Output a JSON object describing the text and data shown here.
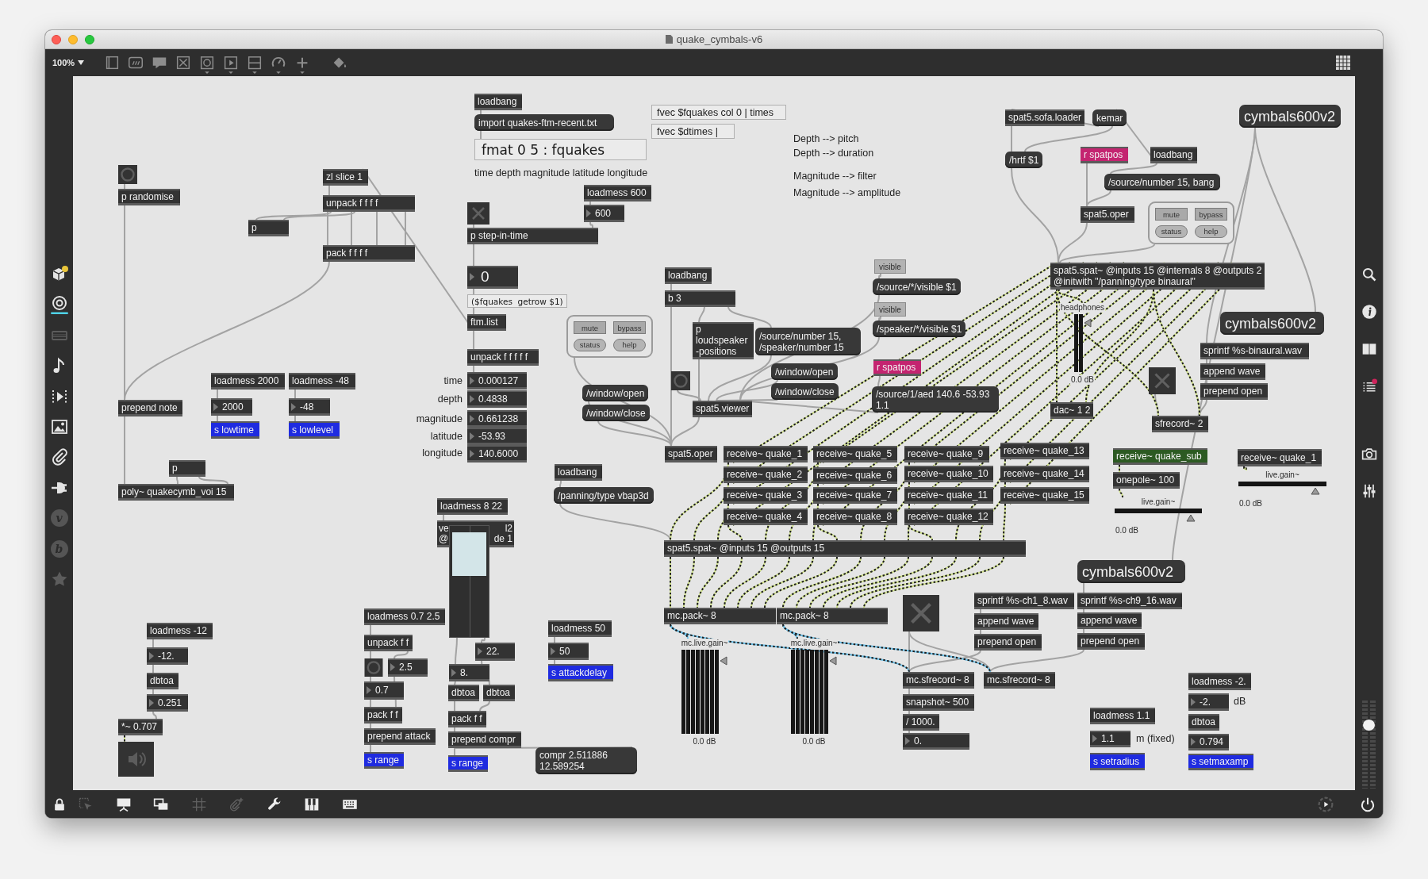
{
  "window": {
    "title": "quake_cymbals-v6"
  },
  "toolbar": {
    "zoom": "100%"
  },
  "left_sidebar": {
    "items": [
      {
        "kind": "icon",
        "selected": false,
        "disabled": false
      },
      {
        "kind": "icon",
        "selected": true,
        "disabled": false
      },
      {
        "kind": "icon",
        "selected": false,
        "disabled": true
      },
      {
        "kind": "icon",
        "selected": false,
        "disabled": false
      },
      {
        "kind": "icon",
        "selected": false,
        "disabled": false
      },
      {
        "kind": "icon",
        "selected": false,
        "disabled": false
      },
      {
        "kind": "icon",
        "selected": false,
        "disabled": false
      },
      {
        "kind": "icon",
        "selected": false,
        "disabled": false
      },
      {
        "kind": "letter",
        "label": "v",
        "selected": false,
        "disabled": true
      },
      {
        "kind": "letter",
        "label": "b",
        "selected": false,
        "disabled": true
      },
      {
        "kind": "icon",
        "selected": false,
        "disabled": true
      }
    ]
  },
  "right_sidebar": {
    "volume": {
      "level": 0.75
    }
  },
  "patcher": {
    "objects": [
      {
        "kind": "object",
        "text": "loadbang"
      },
      {
        "kind": "message",
        "text": "import quakes-ftm-recent.txt"
      },
      {
        "kind": "ftm",
        "text": "fvec $fquakes col 0 | times"
      },
      {
        "kind": "ftm",
        "text": "fvec $dtimes |"
      },
      {
        "kind": "object",
        "text": "spat5.sofa.loader"
      },
      {
        "kind": "message",
        "text": "kemar"
      },
      {
        "kind": "bigmessage",
        "text": "cymbals600v2"
      },
      {
        "kind": "ftmlarge",
        "text": "fmat 0 5 : fquakes"
      },
      {
        "kind": "comment",
        "text": "Depth --> pitch"
      },
      {
        "kind": "comment",
        "text": "Depth --> duration"
      },
      {
        "kind": "bang"
      },
      {
        "kind": "object",
        "text": "zl slice 1"
      },
      {
        "kind": "comment",
        "text": "time depth magnitude latitude longitude"
      },
      {
        "kind": "message",
        "text": "/hrtf $1"
      },
      {
        "kind": "receive",
        "text": "r spatpos"
      },
      {
        "kind": "object",
        "text": "loadbang"
      },
      {
        "kind": "comment",
        "text": "Magnitude --> filter"
      },
      {
        "kind": "object",
        "text": "p randomise"
      },
      {
        "kind": "object",
        "text": "unpack f f f f"
      },
      {
        "kind": "object",
        "text": "loadmess 600"
      },
      {
        "kind": "comment",
        "text": "Magnitude --> amplitude"
      },
      {
        "kind": "message",
        "text": "/source/number 15, bang"
      },
      {
        "kind": "object",
        "text": "p"
      },
      {
        "kind": "toggle",
        "checked": false
      },
      {
        "kind": "number",
        "text": "600"
      },
      {
        "kind": "object",
        "text": "spat5.oper"
      },
      {
        "kind": "object",
        "text": "p step-in-time"
      },
      {
        "kind": "panel",
        "buttons": [
          {
            "kind": "toggle",
            "label": "mute"
          },
          {
            "kind": "toggle",
            "label": "bypass"
          },
          {
            "kind": "action",
            "label": "status"
          },
          {
            "kind": "action",
            "label": "help"
          }
        ]
      },
      {
        "kind": "object",
        "text": "pack f f f f"
      },
      {
        "kind": "bignumber",
        "text": "0"
      },
      {
        "kind": "object",
        "text": "loadbang"
      },
      {
        "kind": "textbutton",
        "text": "visible"
      },
      {
        "kind": "ftmsmall",
        "text": "($fquakes  getrow $1)"
      },
      {
        "kind": "object",
        "text": "b 3"
      },
      {
        "kind": "message",
        "text": "/source/*/visible $1"
      },
      {
        "kind": "object",
        "lines": [
          "spat5.spat~ @inputs 15 @internals 8 @outputs 2",
          "@initwith \"/panning/type binaural\""
        ]
      },
      {
        "kind": "object",
        "text": "ftm.list"
      },
      {
        "kind": "object",
        "text": "unpack f f f f f"
      },
      {
        "kind": "panel",
        "buttons": [
          {
            "kind": "toggle",
            "label": "mute"
          },
          {
            "kind": "toggle",
            "label": "bypass"
          },
          {
            "kind": "action",
            "label": "status"
          },
          {
            "kind": "action",
            "label": "help"
          }
        ]
      },
      {
        "kind": "textbutton",
        "text": "visible"
      },
      {
        "kind": "object",
        "lines": [
          "p",
          "loudspeaker",
          "-positions"
        ]
      },
      {
        "kind": "message",
        "lines": [
          "/source/number 15,",
          "/speaker/number 15"
        ]
      },
      {
        "kind": "message",
        "text": "/speaker/*/visible $1"
      },
      {
        "kind": "object",
        "text": "loadmess 2000"
      },
      {
        "kind": "object",
        "text": "loadmess -48"
      },
      {
        "kind": "label",
        "text": "time"
      },
      {
        "kind": "number",
        "text": "0.000127"
      },
      {
        "kind": "object",
        "text": "prepend note"
      },
      {
        "kind": "number",
        "text": "2000"
      },
      {
        "kind": "number",
        "text": "-48"
      },
      {
        "kind": "label",
        "text": "depth"
      },
      {
        "kind": "number",
        "text": "0.4838"
      },
      {
        "kind": "message",
        "text": "/window/open"
      },
      {
        "kind": "bang"
      },
      {
        "kind": "message",
        "text": "/window/open"
      },
      {
        "kind": "receive",
        "text": "r spatpos"
      },
      {
        "kind": "message",
        "text": "/window/close"
      },
      {
        "kind": "send",
        "text": "s lowtime"
      },
      {
        "kind": "send",
        "text": "s lowlevel"
      },
      {
        "kind": "label",
        "text": "magnitude"
      },
      {
        "kind": "number",
        "text": "0.661238"
      },
      {
        "kind": "message",
        "text": "/window/close"
      },
      {
        "kind": "object",
        "text": "spat5.viewer"
      },
      {
        "kind": "message",
        "lines": [
          "/source/1/aed 140.6 -53.93",
          "1.1"
        ]
      },
      {
        "kind": "gain",
        "label": "headphones",
        "reading": "0.0 dB",
        "level": 0.92
      },
      {
        "kind": "bigmessage",
        "text": "cymbals600v2"
      },
      {
        "kind": "object",
        "text": "sprintf %s-binaural.wav"
      },
      {
        "kind": "toggle",
        "checked": false
      },
      {
        "kind": "object",
        "text": "append wave"
      },
      {
        "kind": "object",
        "text": "prepend open"
      },
      {
        "kind": "object",
        "text": "dac~ 1 2"
      },
      {
        "kind": "label",
        "text": "latitude"
      },
      {
        "kind": "number",
        "text": "-53.93"
      },
      {
        "kind": "object",
        "text": "sfrecord~ 2"
      },
      {
        "kind": "label",
        "text": "longitude"
      },
      {
        "kind": "number",
        "text": "140.6000"
      },
      {
        "kind": "object",
        "text": "spat5.oper"
      },
      {
        "kind": "object",
        "text": "receive~ quake_1"
      },
      {
        "kind": "object",
        "text": "receive~ quake_5"
      },
      {
        "kind": "object",
        "text": "receive~ quake_9"
      },
      {
        "kind": "object",
        "text": "receive~ quake_13"
      },
      {
        "kind": "object",
        "text": "p"
      },
      {
        "kind": "object",
        "text": "loadbang"
      },
      {
        "kind": "subsignal",
        "text": "receive~ quake_sub"
      },
      {
        "kind": "object",
        "text": "receive~ quake_2"
      },
      {
        "kind": "object",
        "text": "receive~ quake_6"
      },
      {
        "kind": "object",
        "text": "receive~ quake_10"
      },
      {
        "kind": "object",
        "text": "receive~ quake_14"
      },
      {
        "kind": "object",
        "text": "receive~ quake_1"
      },
      {
        "kind": "object",
        "text": "poly~ quakecymb_voi 15"
      },
      {
        "kind": "object",
        "text": "loadmess 8 22"
      },
      {
        "kind": "message",
        "text": "/panning/type vbap3d"
      },
      {
        "kind": "object",
        "text": "receive~ quake_3"
      },
      {
        "kind": "object",
        "text": "receive~ quake_7"
      },
      {
        "kind": "object",
        "text": "receive~ quake_11"
      },
      {
        "kind": "object",
        "text": "receive~ quake_15"
      },
      {
        "kind": "object",
        "text": "onepole~ 100"
      },
      {
        "kind": "covered",
        "parts": [
          "ve",
          "l2",
          "@",
          "de 1"
        ]
      },
      {
        "kind": "object",
        "text": "receive~ quake_4"
      },
      {
        "kind": "object",
        "text": "receive~ quake_8"
      },
      {
        "kind": "object",
        "text": "receive~ quake_12"
      },
      {
        "kind": "object",
        "text": "loadmess -12"
      },
      {
        "kind": "object",
        "text": "loadmess 0.7 2.5"
      },
      {
        "kind": "number",
        "text": "-12."
      },
      {
        "kind": "object",
        "text": "unpack f f"
      },
      {
        "kind": "rslider",
        "level": 0.91
      },
      {
        "kind": "object",
        "text": "spat5.spat~ @inputs 15 @outputs 15"
      },
      {
        "kind": "hgain",
        "label": "live.gain~",
        "reading": "0.0 dB",
        "level": 0.92
      },
      {
        "kind": "hgain",
        "label": "live.gain~",
        "reading": "0.0 dB",
        "level": 0.92
      },
      {
        "kind": "bigmessage",
        "text": "cymbals600v2"
      },
      {
        "kind": "object",
        "text": "loadmess 50"
      },
      {
        "kind": "object",
        "text": "mc.pack~ 8"
      },
      {
        "kind": "object",
        "text": "mc.pack~ 8"
      },
      {
        "kind": "toggle",
        "checked": false
      },
      {
        "kind": "object",
        "text": "sprintf %s-ch1_8.wav"
      },
      {
        "kind": "object",
        "text": "sprintf %s-ch9_16.wav"
      },
      {
        "kind": "object",
        "text": "append wave"
      },
      {
        "kind": "object",
        "text": "append wave"
      },
      {
        "kind": "object",
        "text": "dbtoa"
      },
      {
        "kind": "bang"
      },
      {
        "kind": "number",
        "text": "2.5"
      },
      {
        "kind": "number",
        "text": "22."
      },
      {
        "kind": "number",
        "text": "50"
      },
      {
        "kind": "number",
        "text": "8."
      },
      {
        "kind": "send",
        "text": "s attackdelay"
      },
      {
        "kind": "number",
        "text": "0.251"
      },
      {
        "kind": "number",
        "text": "0.7"
      },
      {
        "kind": "object",
        "text": "dbtoa"
      },
      {
        "kind": "object",
        "text": "dbtoa"
      },
      {
        "kind": "object",
        "text": "*~ 0.707"
      },
      {
        "kind": "object",
        "text": "pack f f"
      },
      {
        "kind": "object",
        "text": "pack f f"
      },
      {
        "kind": "ezdac",
        "on": false
      },
      {
        "kind": "object",
        "text": "prepend attack"
      },
      {
        "kind": "object",
        "text": "prepend compr"
      },
      {
        "kind": "send",
        "text": "s range"
      },
      {
        "kind": "send",
        "text": "s range"
      },
      {
        "kind": "message",
        "lines": [
          "compr 2.511886",
          "12.589254"
        ]
      },
      {
        "kind": "mcgain",
        "label": "mc.live.gain~",
        "reading": "0.0 dB",
        "level": 0.92
      },
      {
        "kind": "mcgain",
        "label": "mc.live.gain~",
        "reading": "0.0 dB",
        "level": 0.92
      },
      {
        "kind": "object",
        "text": "prepend open"
      },
      {
        "kind": "object",
        "text": "prepend open"
      },
      {
        "kind": "object",
        "text": "mc.sfrecord~ 8"
      },
      {
        "kind": "object",
        "text": "mc.sfrecord~ 8"
      },
      {
        "kind": "object",
        "text": "loadmess -2."
      },
      {
        "kind": "object",
        "text": "snapshot~ 500"
      },
      {
        "kind": "object",
        "text": "/ 1000."
      },
      {
        "kind": "object",
        "text": "loadmess 1.1"
      },
      {
        "kind": "number",
        "text": "-2."
      },
      {
        "kind": "comment",
        "text": "dB"
      },
      {
        "kind": "object",
        "text": "dbtoa"
      },
      {
        "kind": "number",
        "text": "0."
      },
      {
        "kind": "number",
        "text": "1.1"
      },
      {
        "kind": "comment",
        "text": "m (fixed)"
      },
      {
        "kind": "number",
        "text": "0.794"
      },
      {
        "kind": "send",
        "text": "s setradius"
      },
      {
        "kind": "send",
        "text": "s setmaxamp"
      }
    ]
  },
  "bottom_bar": {
    "tools": [
      {
        "disabled": false
      },
      {
        "disabled": true
      },
      {
        "disabled": false
      },
      {
        "disabled": false
      },
      {
        "disabled": true
      },
      {
        "disabled": true
      },
      {
        "disabled": false
      },
      {
        "disabled": false
      },
      {
        "disabled": false
      }
    ]
  }
}
